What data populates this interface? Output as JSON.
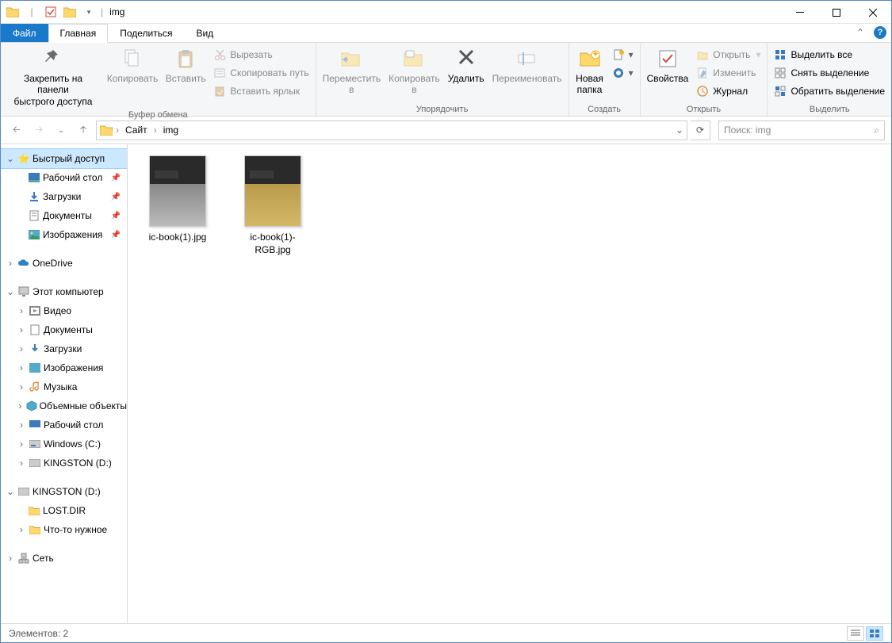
{
  "window": {
    "title": "img"
  },
  "tabs": {
    "file": "Файл",
    "home": "Главная",
    "share": "Поделиться",
    "view": "Вид"
  },
  "ribbon": {
    "clipboard": {
      "pin": "Закрепить на панели\nбыстрого доступа",
      "copy": "Копировать",
      "paste": "Вставить",
      "cut": "Вырезать",
      "copy_path": "Скопировать путь",
      "paste_shortcut": "Вставить ярлык",
      "label": "Буфер обмена"
    },
    "organize": {
      "move_to": "Переместить\nв",
      "copy_to": "Копировать\nв",
      "delete": "Удалить",
      "rename": "Переименовать",
      "label": "Упорядочить"
    },
    "new": {
      "new_folder": "Новая\nпапка",
      "label": "Создать"
    },
    "open": {
      "properties": "Свойства",
      "open": "Открыть",
      "edit": "Изменить",
      "history": "Журнал",
      "label": "Открыть"
    },
    "select": {
      "select_all": "Выделить все",
      "select_none": "Снять выделение",
      "invert": "Обратить выделение",
      "label": "Выделить"
    }
  },
  "breadcrumb": {
    "root": "Сайт",
    "current": "img"
  },
  "search": {
    "placeholder": "Поиск: img"
  },
  "tree": {
    "quick_access": "Быстрый доступ",
    "desktop": "Рабочий стол",
    "downloads": "Загрузки",
    "documents": "Документы",
    "pictures": "Изображения",
    "onedrive": "OneDrive",
    "this_pc": "Этот компьютер",
    "videos": "Видео",
    "documents2": "Документы",
    "downloads2": "Загрузки",
    "pictures2": "Изображения",
    "music": "Музыка",
    "objects3d": "Объемные объекты",
    "desktop2": "Рабочий стол",
    "windows_c": "Windows (C:)",
    "kingston_d": "KINGSTON (D:)",
    "kingston_d2": "KINGSTON (D:)",
    "lost_dir": "LOST.DIR",
    "something": "Что-то нужное",
    "network": "Сеть"
  },
  "files": {
    "0": {
      "name": "ic-book(1).jpg"
    },
    "1": {
      "name": "ic-book(1)-RGB.jpg"
    }
  },
  "status": {
    "items": "Элементов: 2"
  }
}
